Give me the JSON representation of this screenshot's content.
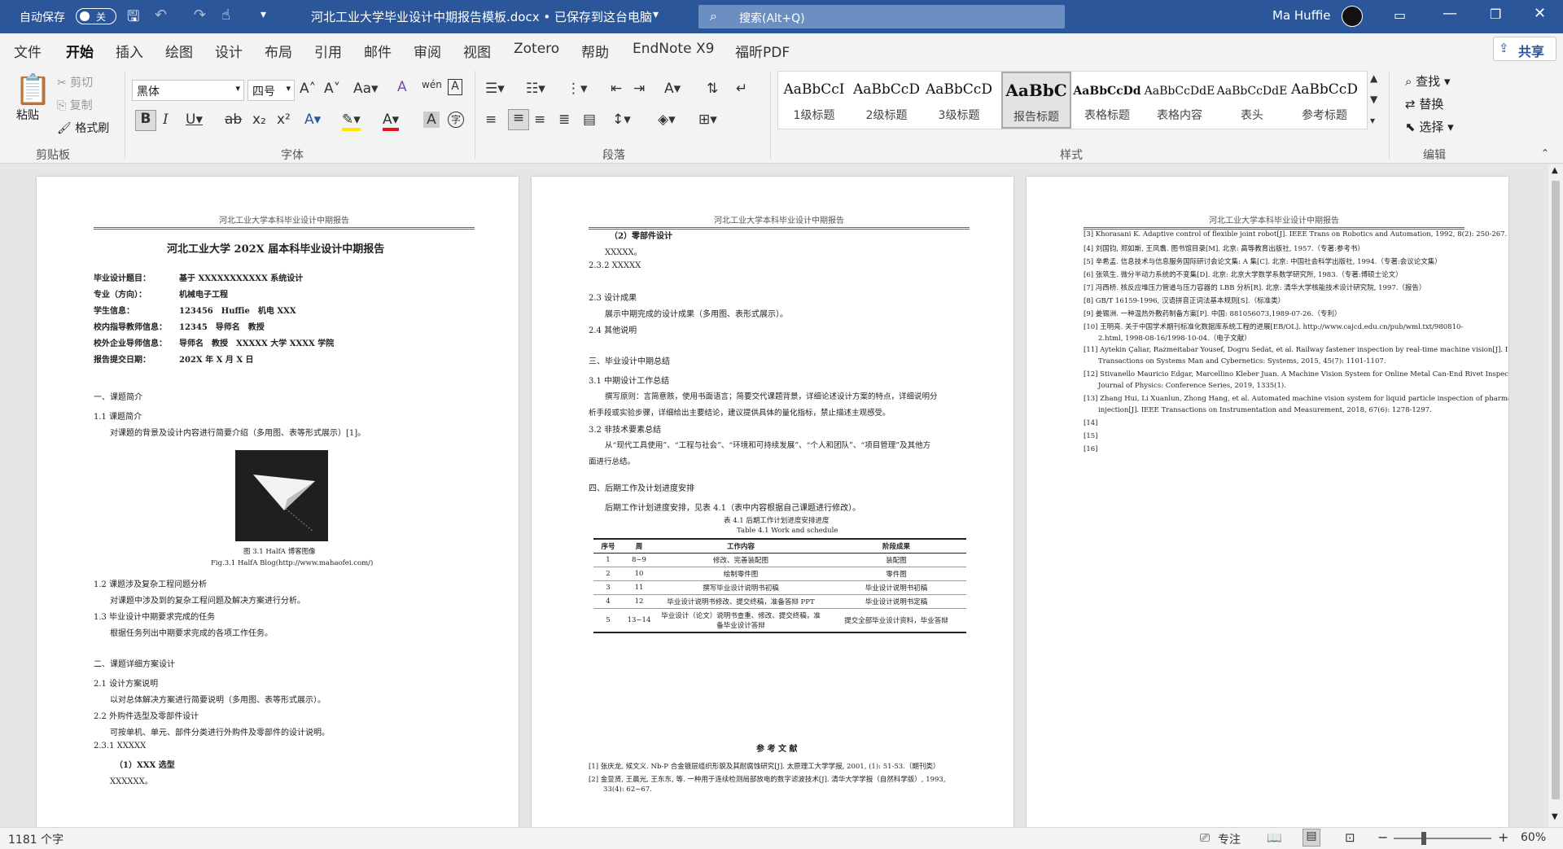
{
  "titlebar": {
    "autosave_label": "自动保存",
    "autosave_state": "关",
    "doc_title": "河北工业大学毕业设计中期报告模板.docx • 已保存到这台电脑",
    "search_placeholder": "搜索(Alt+Q)",
    "user_name": "Ma Huffie"
  },
  "menu": {
    "tabs": [
      "文件",
      "开始",
      "插入",
      "绘图",
      "设计",
      "布局",
      "引用",
      "邮件",
      "审阅",
      "视图",
      "Zotero",
      "帮助",
      "EndNote X9",
      "福昕PDF"
    ],
    "share": "共享"
  },
  "ribbon": {
    "clipboard": {
      "paste": "粘贴",
      "cut": "剪切",
      "copy": "复制",
      "format_painter": "格式刷",
      "label": "剪贴板"
    },
    "font": {
      "name": "黑体",
      "size": "四号",
      "label": "字体"
    },
    "paragraph": {
      "label": "段落"
    },
    "styles": {
      "label": "样式",
      "items": [
        {
          "sample": "AaBbCcI",
          "name": "1级标题"
        },
        {
          "sample": "AaBbCcD",
          "name": "2级标题"
        },
        {
          "sample": "AaBbCcD",
          "name": "3级标题"
        },
        {
          "sample": "AaBbC",
          "name": "报告标题"
        },
        {
          "sample": "AaBbCcDd",
          "name": "表格标题"
        },
        {
          "sample": "AaBbCcDdE",
          "name": "表格内容"
        },
        {
          "sample": "AaBbCcDdE",
          "name": "表头"
        },
        {
          "sample": "AaBbCcD",
          "name": "参考标题"
        }
      ]
    },
    "editing": {
      "find": "查找",
      "replace": "替换",
      "select": "选择",
      "label": "编辑"
    }
  },
  "page1": {
    "header": "河北工业大学本科毕业设计中期报告",
    "title": "河北工业大学 202X 届本科毕业设计中期报告",
    "info": [
      {
        "k": "毕业设计题目：",
        "v": "基于 XXXXXXXXXXX 系统设计"
      },
      {
        "k": "专业（方向）：",
        "v": "机械电子工程"
      },
      {
        "k": "学生信息：",
        "v": "123456　Huffie　机电 XXX"
      },
      {
        "k": "校内指导教师信息：",
        "v": "12345　导师名　教授"
      },
      {
        "k": "校外企业导师信息：",
        "v": "导师名　教授　XXXXX 大学 XXXX 学院"
      },
      {
        "k": "报告提交日期：",
        "v": "202X 年 X 月 X 日"
      }
    ],
    "s1": "一、课题简介",
    "s1_1": "1.1  课题简介",
    "s1_1_body": "对课题的背景及设计内容进行简要介绍（多用图、表等形式展示）[1]。",
    "fig_cn": "图 3.1 HalfA 博客图像",
    "fig_en": "Fig.3.1 HalfA Blog(http://www.mahaofei.com/)",
    "s1_2": "1.2  课题涉及复杂工程问题分析",
    "s1_2_body": "对课题中涉及到的复杂工程问题及解决方案进行分析。",
    "s1_3": "1.3  毕业设计中期要求完成的任务",
    "s1_3_body": "根据任务列出中期要求完成的各项工作任务。",
    "s2": "二、课题详细方案设计",
    "s2_1": "2.1  设计方案说明",
    "s2_1_body": "以对总体解决方案进行简要说明（多用图、表等形式展示）。",
    "s2_2": "2.2  外购件选型及零部件设计",
    "s2_2_body": "可按单机、单元、部件分类进行外购件及零部件的设计说明。",
    "s2_3_1": "2.3.1 XXXXX",
    "s2_3_1_a": "（1）XXX 选型",
    "s2_3_1_a_body": "XXXXXX。"
  },
  "page2": {
    "header": "河北工业大学本科毕业设计中期报告",
    "a2": "（2）零部件设计",
    "a2_body": "XXXXX。",
    "s2_3_2": "2.3.2 XXXXX",
    "s2_3": "2.3  设计成果",
    "s2_3_body": "展示中期完成的设计成果（多用图、表形式展示）。",
    "s2_4": "2.4  其他说明",
    "s3": "三、毕业设计中期总结",
    "s3_1": "3.1  中期设计工作总结",
    "s3_1_body1": "撰写原则：言简意赅，使用书面语言；简要交代课题背景，详细论述设计方案的特点，详细说明分",
    "s3_1_body2": "析手段或实验步骤，详细给出主要结论，建议提供具体的量化指标，禁止描述主观感受。",
    "s3_2": "3.2  非技术要素总结",
    "s3_2_body1": "从“现代工具使用”、“工程与社会”、“环境和可持续发展”、“个人和团队”、“项目管理”及其他方",
    "s3_2_body2": "面进行总结。",
    "s4": "四、后期工作及计划进度安排",
    "s4_body": "后期工作计划进度安排，见表 4.1（表中内容根据自己课题进行修改）。",
    "table_cn": "表 4.1  后期工作计划进度安排进度",
    "table_en": "Table 4.1 Work and schedule",
    "table_headers": [
      "序号",
      "周",
      "工作内容",
      "阶段成果"
    ],
    "table_rows": [
      [
        "1",
        "8~9",
        "修改、完善装配图",
        "装配图"
      ],
      [
        "2",
        "10",
        "绘制零件图",
        "零件图"
      ],
      [
        "3",
        "11",
        "撰写毕业设计说明书初稿",
        "毕业设计说明书初稿"
      ],
      [
        "4",
        "12",
        "毕业设计说明书修改、提交终稿，准备答辩 PPT",
        "毕业设计说明书定稿"
      ],
      [
        "5",
        "13~14",
        "毕业设计（论文）说明书查重、修改、提交终稿，准备毕业设计答辩",
        "提交全部毕业设计资料，毕业答辩"
      ]
    ],
    "ref_title": "参 考 文 献",
    "refs": [
      "[1]  张庆龙, 候文义. Nb-P 合金镀层组织形貌及其耐腐蚀研究[J]. 太原理工大学学报, 2001, (1): 51-53.（期刊类）",
      "[2]  金显贤, 王晨光, 王东东, 等. 一种用于连续检测局部放电的数字滤波技术[J]. 清华大学学报（自然科学版）, 1993,",
      "33(4): 62~67."
    ]
  },
  "page3": {
    "header": "河北工业大学本科毕业设计中期报告",
    "refs": [
      "[3]   Khorasani K. Adaptive control of flexible joint robot[J]. IEEE Trans on Robotics and Automation, 1992, 8(2): 250-267.",
      "[4]   刘国钧, 郑如斯, 王凤翥. 图书馆目录[M]. 北京: 高等教育出版社, 1957.（专著:参考书）",
      "[5]   辛希孟. 信息技术与信息服务国际研讨会论文集: A 集[C]. 北京: 中国社会科学出版社, 1994.（专著:会议论文集）",
      "[6]   张筑生. 微分半动力系统的不变集[D]. 北京: 北京大学数学系数学研究所, 1983.（专著:博硕士论文）",
      "[7]   冯西桥. 核反应堆压力管道与压力容器的 LBB 分析[R]. 北京: 清华大学核能技术设计研究院, 1997.（报告）",
      "[8]   GB/T 16159-1996, 汉语拼音正词法基本规则[S].（标准类）",
      "[9]   姜锡洲. 一种温热外敷药制备方案[P]. 中国: 881056073,1989-07-26.（专利）",
      "[10]  王明亮. 关于中国学术期刊标准化数据库系统工程的进展[EB/OL]. http://www.cajcd.edu.cn/pub/wml.txt/980810-",
      "2.html, 1998-08-16/1998-10-04.（电子文献）",
      "[11]  Aytekin Çaliar, Razmeitabar Yousef, Dogru Sedat, et al. Railway fastener inspection by real-time machine vision[J]. IEEE",
      "Transactions on Systems Man and Cybernetics: Systems, 2015, 45(7): 1101-1107.",
      "[12]  Stivanello Mauricio Edgar, Marcellino Kleber Juan. A Machine Vision System for Online Metal Can-End Rivet Inspection[J].",
      "Journal of Physics: Conference Series, 2019, 1335(1).",
      "[13]  Zhang Hui, Li Xuanlun, Zhong Hang, et al. Automated machine vision system for liquid particle inspection of pharmaceutical",
      "injection[J]. IEEE Transactions on Instrumentation and Measurement, 2018, 67(6): 1278-1297.",
      "[14]",
      "[15]",
      "[16]"
    ]
  },
  "status": {
    "word_count": "1181 个字",
    "focus": "专注",
    "zoom": "60%"
  }
}
